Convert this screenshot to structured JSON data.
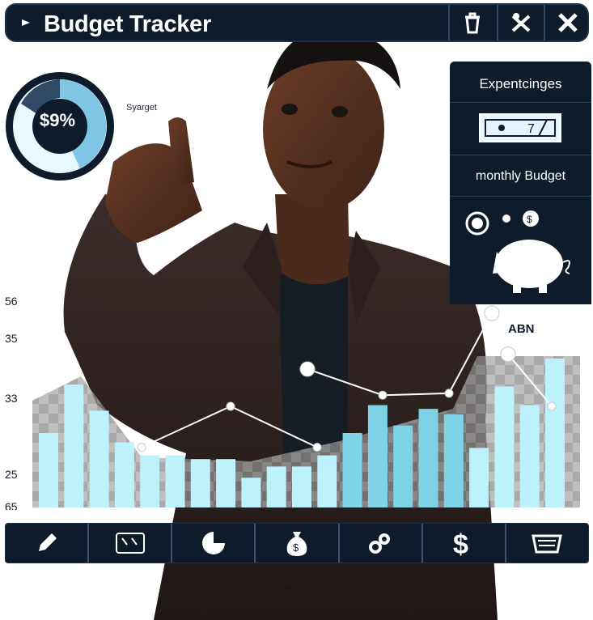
{
  "app": {
    "title": "Budget Tracker"
  },
  "titlebar": {
    "buttons": [
      {
        "icon": "trash-icon"
      },
      {
        "icon": "tools-icon"
      },
      {
        "icon": "close-icon"
      }
    ]
  },
  "donut": {
    "label": "$9%",
    "tag": "Syarget"
  },
  "right_panel": {
    "heading1": "Expentcinges",
    "card_value": "7",
    "heading2": "monthly Budget",
    "chart_label": "ABN"
  },
  "chart_data": {
    "type": "bar",
    "y_tick_labels": [
      "56",
      "35",
      "33",
      "25",
      "65"
    ],
    "values": [
      0.4,
      0.66,
      0.52,
      0.35,
      0.28,
      0.28,
      0.26,
      0.26,
      0.16,
      0.22,
      0.22,
      0.28,
      0.4,
      0.55,
      0.44,
      0.53,
      0.5,
      0.32,
      0.65,
      0.55,
      0.8
    ],
    "line": [
      0.28,
      0.5,
      0.28,
      0.7,
      0.56,
      0.57,
      1.0,
      0.78,
      0.5
    ]
  },
  "toolbar": {
    "tools": [
      {
        "icon": "pencil-icon"
      },
      {
        "icon": "wallet-card-icon"
      },
      {
        "icon": "pie-chart-icon"
      },
      {
        "icon": "money-bag-icon"
      },
      {
        "icon": "coins-icon"
      },
      {
        "icon": "dollar-sign-icon"
      },
      {
        "icon": "basket-icon"
      }
    ]
  },
  "colors": {
    "panel": "#0e1b2a",
    "bar": "#bdf1fb",
    "bar_dark": "#7ed3e6",
    "checker": "#8f8f8f"
  }
}
